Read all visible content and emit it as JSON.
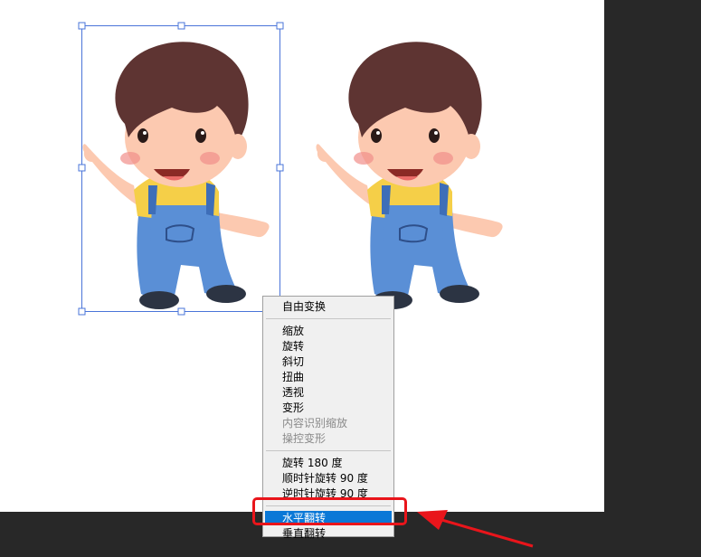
{
  "menu": {
    "items": [
      {
        "label": "自由变换",
        "enabled": true
      },
      {
        "separator": true
      },
      {
        "label": "缩放",
        "enabled": true
      },
      {
        "label": "旋转",
        "enabled": true
      },
      {
        "label": "斜切",
        "enabled": true
      },
      {
        "label": "扭曲",
        "enabled": true
      },
      {
        "label": "透视",
        "enabled": true
      },
      {
        "label": "变形",
        "enabled": true
      },
      {
        "label": "内容识别缩放",
        "enabled": false
      },
      {
        "label": "操控变形",
        "enabled": false
      },
      {
        "separator": true
      },
      {
        "label": "旋转 180 度",
        "enabled": true
      },
      {
        "label": "顺时针旋转 90 度",
        "enabled": true
      },
      {
        "label": "逆时针旋转 90 度",
        "enabled": true
      },
      {
        "separator": true
      },
      {
        "label": "水平翻转",
        "enabled": true,
        "selected": true
      },
      {
        "label": "垂直翻转",
        "enabled": true
      }
    ]
  },
  "colors": {
    "workspace": "#282828",
    "canvas": "#ffffff",
    "selection_blue": "#0a78d7",
    "annotation_red": "#e9151b",
    "hair": "#5e3432",
    "skin": "#fcc9b0",
    "shirt": "#f5cf48",
    "overalls": "#5a8fd6",
    "shoes": "#2c3443"
  }
}
